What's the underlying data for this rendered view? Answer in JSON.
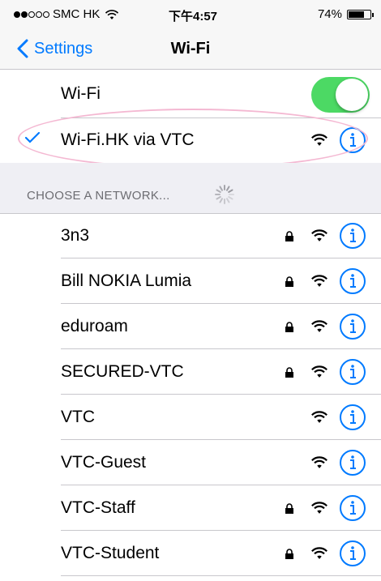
{
  "status_bar": {
    "carrier": "SMC HK",
    "signal_dots": [
      true,
      true,
      false,
      false,
      false
    ],
    "time": "下午4:57",
    "battery": "74%",
    "battery_level": 0.74
  },
  "nav": {
    "back_label": "Settings",
    "title": "Wi-Fi"
  },
  "wifi_toggle": {
    "label": "Wi-Fi",
    "on": true
  },
  "connected": {
    "name": "Wi-Fi.HK via VTC",
    "locked": false
  },
  "section": {
    "title": "CHOOSE A NETWORK..."
  },
  "networks": [
    {
      "name": "3n3",
      "locked": true
    },
    {
      "name": "Bill NOKIA Lumia",
      "locked": true
    },
    {
      "name": "eduroam",
      "locked": true
    },
    {
      "name": "SECURED-VTC",
      "locked": true
    },
    {
      "name": "VTC",
      "locked": false
    },
    {
      "name": "VTC-Guest",
      "locked": false
    },
    {
      "name": "VTC-Staff",
      "locked": true
    },
    {
      "name": "VTC-Student",
      "locked": true
    }
  ],
  "colors": {
    "accent": "#007aff",
    "toggle_on": "#4cd964",
    "highlight": "#f4b8d2"
  }
}
